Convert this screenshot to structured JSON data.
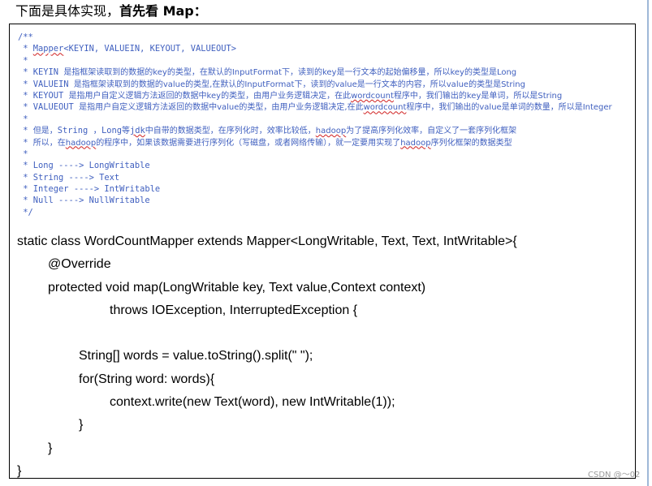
{
  "heading": {
    "prefix": "下面是具体实现，",
    "bold": "首先看 Map："
  },
  "comment_lines": [
    [
      {
        "t": "/**"
      }
    ],
    [
      {
        "t": " * "
      },
      {
        "t": "Mapper",
        "wavy": true
      },
      {
        "t": "<KEYIN, VALUEIN, KEYOUT, VALUEOUT>"
      }
    ],
    [
      {
        "t": " *"
      }
    ],
    [
      {
        "t": " * KEYIN "
      },
      {
        "t": "是指框架读取到的数据的key的类型，在默认的InputFormat下，读到的key是一行文本的起始偏移量，所以key的类型是Long",
        "zh": true
      }
    ],
    [
      {
        "t": " * VALUEIN "
      },
      {
        "t": "是指框架读取到的数据的value的类型,在默认的InputFormat下，读到的value是一行文本的内容，所以value的类型是String",
        "zh": true
      }
    ],
    [
      {
        "t": " * KEYOUT "
      },
      {
        "t": "是指用户自定义逻辑方法返回的数据中key的类型，由用户业务逻辑决定，在此",
        "zh": true
      },
      {
        "t": "wordcount",
        "zh": true,
        "wavy": true
      },
      {
        "t": "程序中，我们输出的key是单词，所以是String",
        "zh": true
      }
    ],
    [
      {
        "t": " * VALUEOUT "
      },
      {
        "t": "是指用户自定义逻辑方法返回的数据中value的类型，由用户业务逻辑决定,在此",
        "zh": true
      },
      {
        "t": "wordcount",
        "zh": true,
        "wavy": true
      },
      {
        "t": "程序中，我们输出的value是单词的数量，所以是Integer",
        "zh": true
      }
    ],
    [
      {
        "t": " *"
      }
    ],
    [
      {
        "t": " * "
      },
      {
        "t": "但是，",
        "zh": true
      },
      {
        "t": "String ，Long"
      },
      {
        "t": "等",
        "zh": true
      },
      {
        "t": "jdk",
        "wavy": true
      },
      {
        "t": "中自带的数据类型，在序列化时，效率比较低，",
        "zh": true
      },
      {
        "t": "hadoop",
        "zh": true,
        "wavy": true
      },
      {
        "t": "为了提高序列化效率，自定义了一套序列化框架",
        "zh": true
      }
    ],
    [
      {
        "t": " * "
      },
      {
        "t": "所以，在",
        "zh": true
      },
      {
        "t": "hadoop",
        "zh": true,
        "wavy": true
      },
      {
        "t": "的程序中，如果该数据需要进行序列化（写磁盘，或者网络传输），就一定要用实现了",
        "zh": true
      },
      {
        "t": "hadoop",
        "zh": true,
        "wavy": true
      },
      {
        "t": "序列化框架的数据类型",
        "zh": true
      }
    ],
    [
      {
        "t": " *"
      }
    ],
    [
      {
        "t": " * Long ----> LongWritable"
      }
    ],
    [
      {
        "t": " * String ----> Text"
      }
    ],
    [
      {
        "t": " * Integer ----> IntWritable"
      }
    ],
    [
      {
        "t": " * Null ----> NullWritable"
      }
    ],
    [
      {
        "t": " */"
      }
    ]
  ],
  "code_lines": [
    {
      "indent": 0,
      "text": "static class WordCountMapper extends Mapper<LongWritable, Text, Text, IntWritable>{"
    },
    {
      "indent": 1,
      "text": "@Override"
    },
    {
      "indent": 1,
      "text": "protected void map(LongWritable key, Text value,Context context)"
    },
    {
      "indent": 3,
      "text": "throws IOException, InterruptedException {"
    },
    {
      "indent": 0,
      "text": ""
    },
    {
      "indent": 2,
      "text": "String[] words = value.toString().split(\" \");"
    },
    {
      "indent": 2,
      "text": "for(String word: words){"
    },
    {
      "indent": 3,
      "text": "context.write(new Text(word), new IntWritable(1));"
    },
    {
      "indent": 2,
      "text": "}"
    },
    {
      "indent": 1,
      "text": "}"
    },
    {
      "indent": 0,
      "text": "}"
    }
  ],
  "watermark": "CSDN @～02"
}
